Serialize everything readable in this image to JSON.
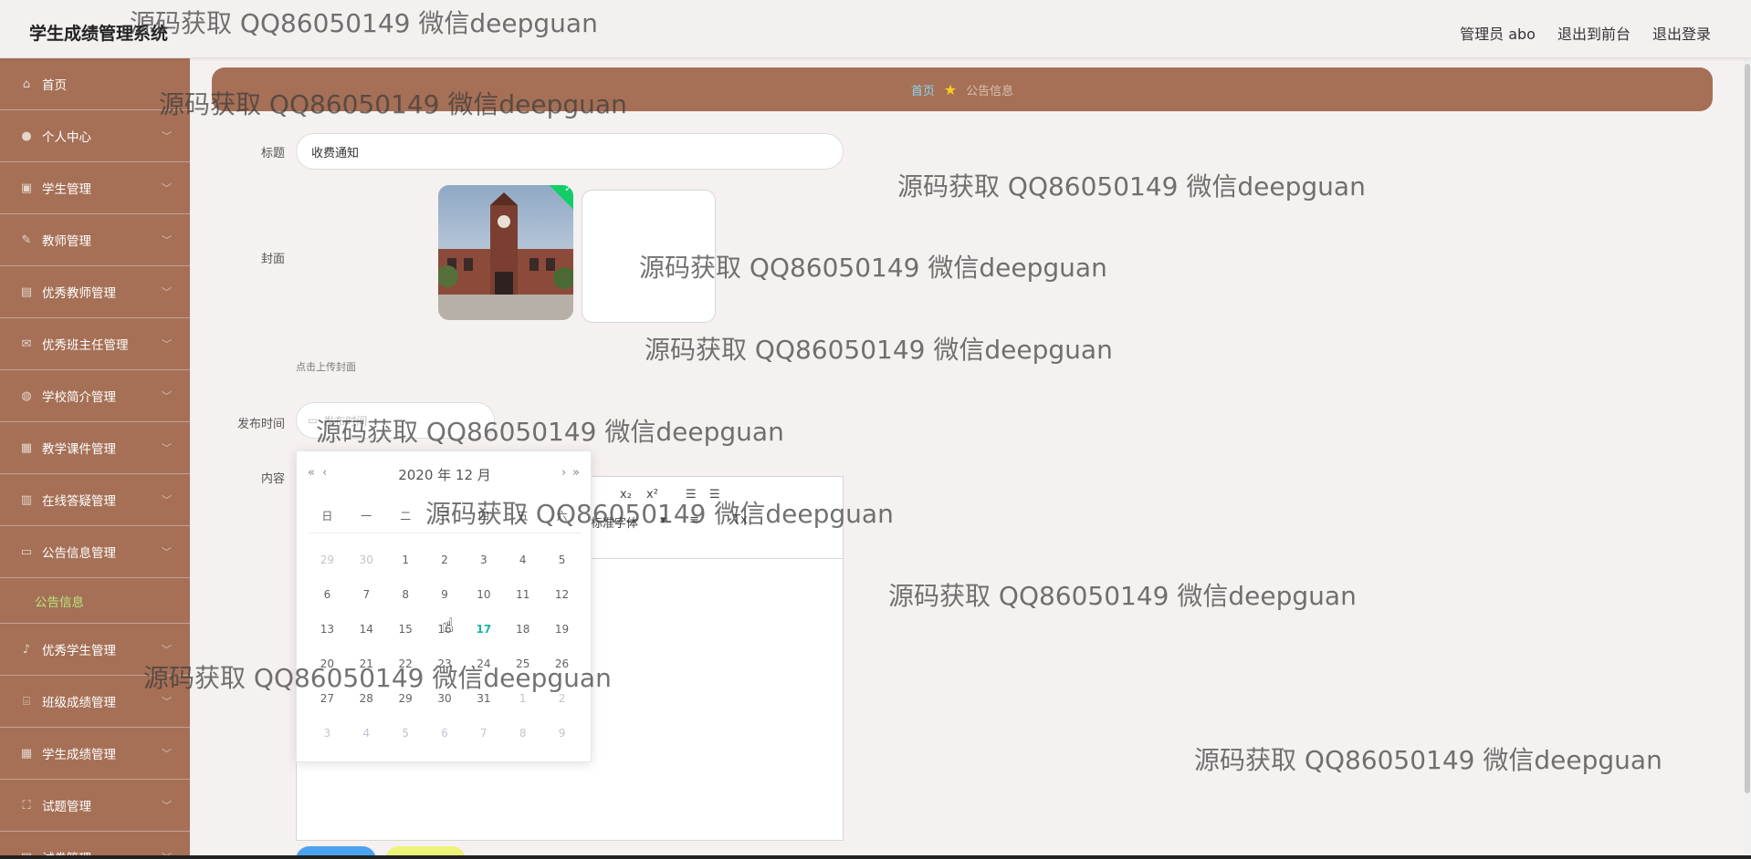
{
  "app_title": "学生成绩管理系统",
  "header": {
    "user": "管理员 abo",
    "front": "退出到前台",
    "logout": "退出登录"
  },
  "sidebar": {
    "items": [
      {
        "label": "首页",
        "icon": "home-icon",
        "chevron": false
      },
      {
        "label": "个人中心",
        "icon": "user-icon",
        "chevron": true
      },
      {
        "label": "学生管理",
        "icon": "student-icon",
        "chevron": true
      },
      {
        "label": "教师管理",
        "icon": "teacher-icon",
        "chevron": true
      },
      {
        "label": "优秀教师管理",
        "icon": "award-icon",
        "chevron": true
      },
      {
        "label": "优秀班主任管理",
        "icon": "mail-icon",
        "chevron": true
      },
      {
        "label": "学校简介管理",
        "icon": "school-icon",
        "chevron": true
      },
      {
        "label": "教学课件管理",
        "icon": "grid-icon",
        "chevron": true
      },
      {
        "label": "在线答疑管理",
        "icon": "chart-icon",
        "chevron": true
      },
      {
        "label": "公告信息管理",
        "icon": "monitor-icon",
        "chevron": true
      }
    ],
    "sub_item": "公告信息",
    "items_after": [
      {
        "label": "优秀学生管理",
        "icon": "mic-icon",
        "chevron": true
      },
      {
        "label": "班级成绩管理",
        "icon": "bank-icon",
        "chevron": true
      },
      {
        "label": "学生成绩管理",
        "icon": "grid-icon",
        "chevron": true
      },
      {
        "label": "试题管理",
        "icon": "frame-icon",
        "chevron": true
      },
      {
        "label": "试卷管理",
        "icon": "doc-icon",
        "chevron": true
      }
    ]
  },
  "breadcrumb": {
    "home": "首页",
    "current": "公告信息"
  },
  "form": {
    "title_label": "标题",
    "title_value": "收费通知",
    "cover_label": "封面",
    "upload_hint": "点击上传封面",
    "date_label": "发布时间",
    "date_placeholder": "发布时间",
    "content_label": "内容"
  },
  "editor_toolbar": {
    "sub": "x₂",
    "sup": "x²",
    "font_family": "标准字体",
    "text_align": "≡",
    "clear_format": "Tx"
  },
  "datepicker": {
    "year_month": "2020 年  12 月",
    "prev_year": "«",
    "prev_month": "‹",
    "next_month": "›",
    "next_year": "»",
    "weekdays": [
      "日",
      "一",
      "二",
      "三",
      "四",
      "五",
      "六"
    ],
    "days": [
      {
        "d": "29",
        "t": "other"
      },
      {
        "d": "30",
        "t": "other"
      },
      {
        "d": "1"
      },
      {
        "d": "2"
      },
      {
        "d": "3"
      },
      {
        "d": "4"
      },
      {
        "d": "5"
      },
      {
        "d": "6"
      },
      {
        "d": "7"
      },
      {
        "d": "8"
      },
      {
        "d": "9"
      },
      {
        "d": "10"
      },
      {
        "d": "11"
      },
      {
        "d": "12"
      },
      {
        "d": "13"
      },
      {
        "d": "14"
      },
      {
        "d": "15"
      },
      {
        "d": "16"
      },
      {
        "d": "17",
        "t": "today"
      },
      {
        "d": "18"
      },
      {
        "d": "19"
      },
      {
        "d": "20"
      },
      {
        "d": "21"
      },
      {
        "d": "22"
      },
      {
        "d": "23"
      },
      {
        "d": "24"
      },
      {
        "d": "25"
      },
      {
        "d": "26"
      },
      {
        "d": "27"
      },
      {
        "d": "28"
      },
      {
        "d": "29"
      },
      {
        "d": "30"
      },
      {
        "d": "31"
      },
      {
        "d": "1",
        "t": "other"
      },
      {
        "d": "2",
        "t": "other"
      },
      {
        "d": "3",
        "t": "other"
      },
      {
        "d": "4",
        "t": "other"
      },
      {
        "d": "5",
        "t": "other"
      },
      {
        "d": "6",
        "t": "other"
      },
      {
        "d": "7",
        "t": "other"
      },
      {
        "d": "8",
        "t": "other"
      },
      {
        "d": "9",
        "t": "other"
      }
    ]
  },
  "watermark": "源码获取 QQ86050149 微信deepguan",
  "colors": {
    "sidebar": "#a67056",
    "active_sub": "#b6e67e",
    "today": "#18b8a0",
    "breadcrumb_home": "#8ad6f2",
    "submit": "#4aa3f0",
    "cancel": "#ecf47a"
  }
}
